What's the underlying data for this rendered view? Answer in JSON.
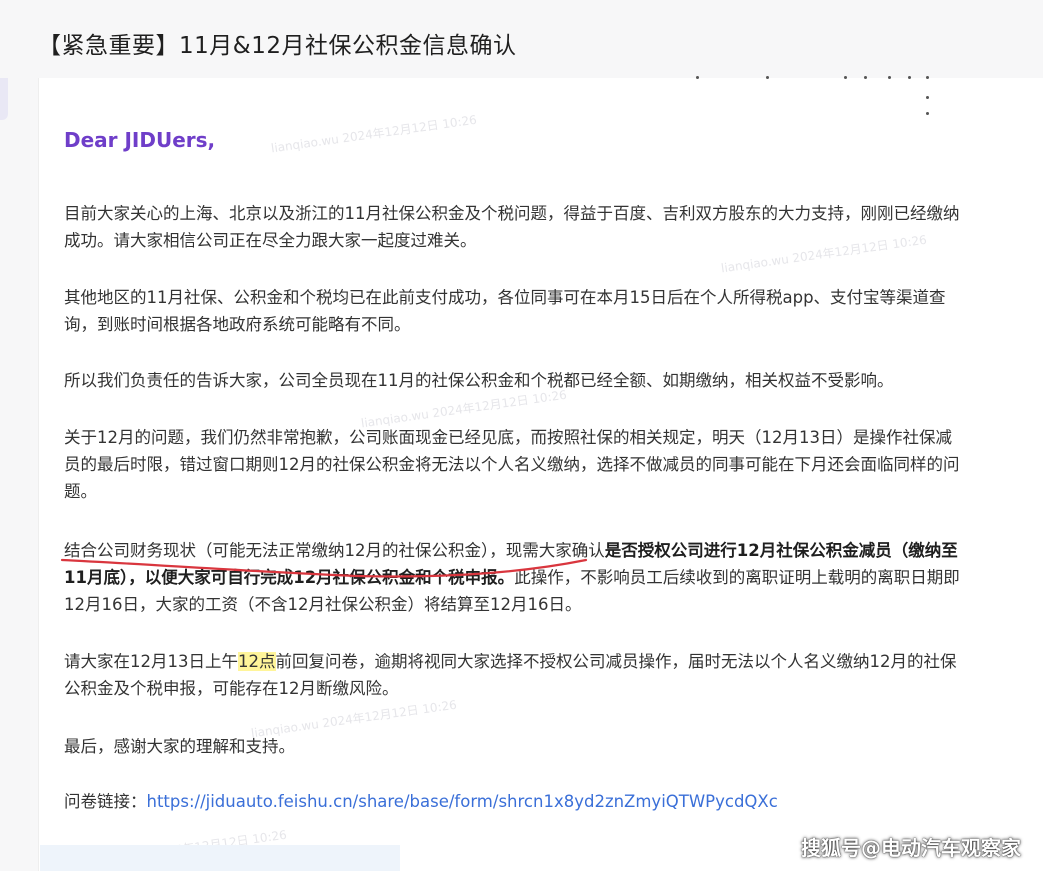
{
  "email": {
    "title": "【紧急重要】11月&12月社保公积金信息确认",
    "greeting": "Dear JIDUers,",
    "p1": "目前大家关心的上海、北京以及浙江的11月社保公积金及个税问题，得益于百度、吉利双方股东的大力支持，刚刚已经缴纳成功。请大家相信公司正在尽全力跟大家一起度过难关。",
    "p2": "其他地区的11月社保、公积金和个税均已在此前支付成功，各位同事可在本月15日后在个人所得税app、支付宝等渠道查询，到账时间根据各地政府系统可能略有不同。",
    "p3": "所以我们负责任的告诉大家，公司全员现在11月的社保公积金和个税都已经全额、如期缴纳，相关权益不受影响。",
    "p4": "关于12月的问题，我们仍然非常抱歉，公司账面现金已经见底，而按照社保的相关规定，明天（12月13日）是操作社保减员的最后时限，错过窗口期则12月的社保公积金将无法以个人名义缴纳，选择不做减员的同事可能在下月还会面临同样的问题。",
    "p5_part1": "结合公司财务现状（可能无法正常缴纳12月的社保公积金），现需大家确认",
    "p5_bold": "是否授权公司进行12月社保公积金减员（缴纳至11月底），以便大家可自行完成12月社保公积金和个税申报。",
    "p5_part2": "此操作，不影响员工后续收到的离职证明上载明的离职日期即12月16日，大家的工资（不含12月社保公积金）将结算至12月16日。",
    "p6_part1": "请大家在12月13日上午",
    "p6_highlight": "12点",
    "p6_part2": "前回复问卷，逾期将视同大家选择不授权公司减员操作，届时无法以个人名义缴纳12月的社保公积金及个税申报，可能存在12月断缴风险。",
    "p7": "最后，感谢大家的理解和支持。",
    "link_label": "问卷链接：",
    "link_url": "https://jiduauto.feishu.cn/share/base/form/shrcn1x8yd2znZmyiQTWPycdQXc"
  },
  "watermark_text": "SOHU @电动汽车观察家",
  "source_watermark": "搜狐号@电动汽车观察家",
  "colors": {
    "greeting": "#6f3ec9",
    "link": "#3a6fd8",
    "highlight": "#fff59a",
    "annotation_red": "#d9363e"
  }
}
